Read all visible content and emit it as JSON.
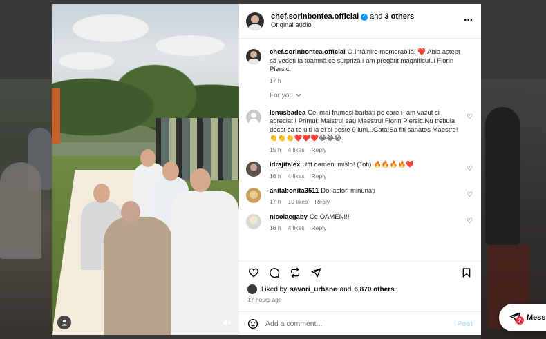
{
  "post": {
    "author": "chef.sorinbontea.official",
    "and_text": "and",
    "others": "3 others",
    "audio": "Original audio",
    "more_icon": "ellipsis-icon"
  },
  "caption": {
    "username": "chef.sorinbontea.official",
    "text": "O întâlnire memorabilă! ❤️ Abia aștept să vedeți la toamnă ce surpriză i-am pregătit magnificului Florin Piersic.",
    "time": "17 h"
  },
  "for_you": "For you",
  "comments": [
    {
      "username": "lenusbadea",
      "text": "Cei mai frumosi barbati pe care i- am vazut si apreciat ! Primul: Maistrul sau Maestrul Florin Piersic.Nu trebuia decat sa te uiti la el si peste 9 luni...Gata!Sa fiti sanatos Maestre! 👏👏👏❤️❤️❤️😂😂😂",
      "time": "15 h",
      "likes": "4 likes",
      "reply": "Reply",
      "avatar_color": "#c9c9c9"
    },
    {
      "username": "idrajitalex",
      "text": "Ufff oameni misto! (Toti) 🔥🔥🔥🔥❤️",
      "time": "16 h",
      "likes": "4 likes",
      "reply": "Reply",
      "avatar_color": "#5b534b"
    },
    {
      "username": "anitabonita3511",
      "text": "Doi actori minunați",
      "time": "17 h",
      "likes": "10 likes",
      "reply": "Reply",
      "avatar_color": "#c9a15b"
    },
    {
      "username": "nicolaegaby",
      "text": "Ce OAMENI!!",
      "time": "16 h",
      "likes": "4 likes",
      "reply": "Reply",
      "avatar_color": "#d9d9d9"
    }
  ],
  "likes": {
    "prefix": "Liked by",
    "user": "savori_urbane",
    "and": "and",
    "others": "6,870 others"
  },
  "timestamp": "17 hours ago",
  "add_comment": {
    "placeholder": "Add a comment...",
    "post_label": "Post"
  },
  "messages": {
    "label": "Messa",
    "badge": "2"
  },
  "colors": {
    "verified": "#0095f6",
    "heart": "#ed4956",
    "post_button": "#b2dffc",
    "muted_text": "#737373"
  }
}
